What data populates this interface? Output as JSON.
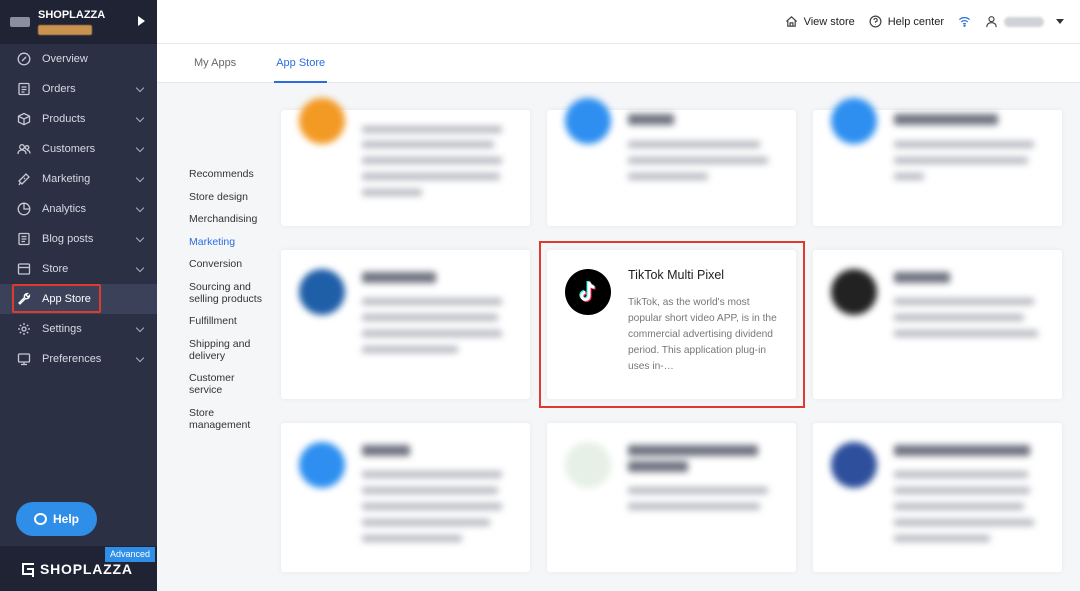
{
  "sidebar": {
    "brand": "SHOPLAZZA",
    "items": [
      {
        "label": "Overview",
        "icon": "overview-icon",
        "has_chevron": false
      },
      {
        "label": "Orders",
        "icon": "orders-icon",
        "has_chevron": true
      },
      {
        "label": "Products",
        "icon": "products-icon",
        "has_chevron": true
      },
      {
        "label": "Customers",
        "icon": "customers-icon",
        "has_chevron": true
      },
      {
        "label": "Marketing",
        "icon": "marketing-icon",
        "has_chevron": true
      },
      {
        "label": "Analytics",
        "icon": "analytics-icon",
        "has_chevron": true
      },
      {
        "label": "Blog posts",
        "icon": "blog-icon",
        "has_chevron": true
      },
      {
        "label": "Store",
        "icon": "store-icon",
        "has_chevron": true
      },
      {
        "label": "App Store",
        "icon": "wrench-icon",
        "has_chevron": false,
        "active": true
      },
      {
        "label": "Settings",
        "icon": "settings-icon",
        "has_chevron": true
      },
      {
        "label": "Preferences",
        "icon": "preferences-icon",
        "has_chevron": true
      }
    ],
    "help_label": "Help",
    "footer_brand": "SHOPLAZZA",
    "advanced_badge": "Advanced",
    "accent_color": "#2f8ee8",
    "highlight_color": "#e03a2f"
  },
  "topbar": {
    "view_store": "View store",
    "help_center": "Help center"
  },
  "tabs": [
    {
      "label": "My Apps",
      "active": false
    },
    {
      "label": "App Store",
      "active": true
    }
  ],
  "categories": [
    "Recommends",
    "Store design",
    "Merchandising",
    "Marketing",
    "Conversion",
    "Sourcing and selling products",
    "Fulfillment",
    "Shipping and delivery",
    "Customer service",
    "Store management"
  ],
  "active_category": "Marketing",
  "featured_app": {
    "title": "TikTok Multi Pixel",
    "description": "TikTok, as the world's most popular short video APP, is in the commercial advertising dividend period. This application plug-in uses in-…"
  }
}
